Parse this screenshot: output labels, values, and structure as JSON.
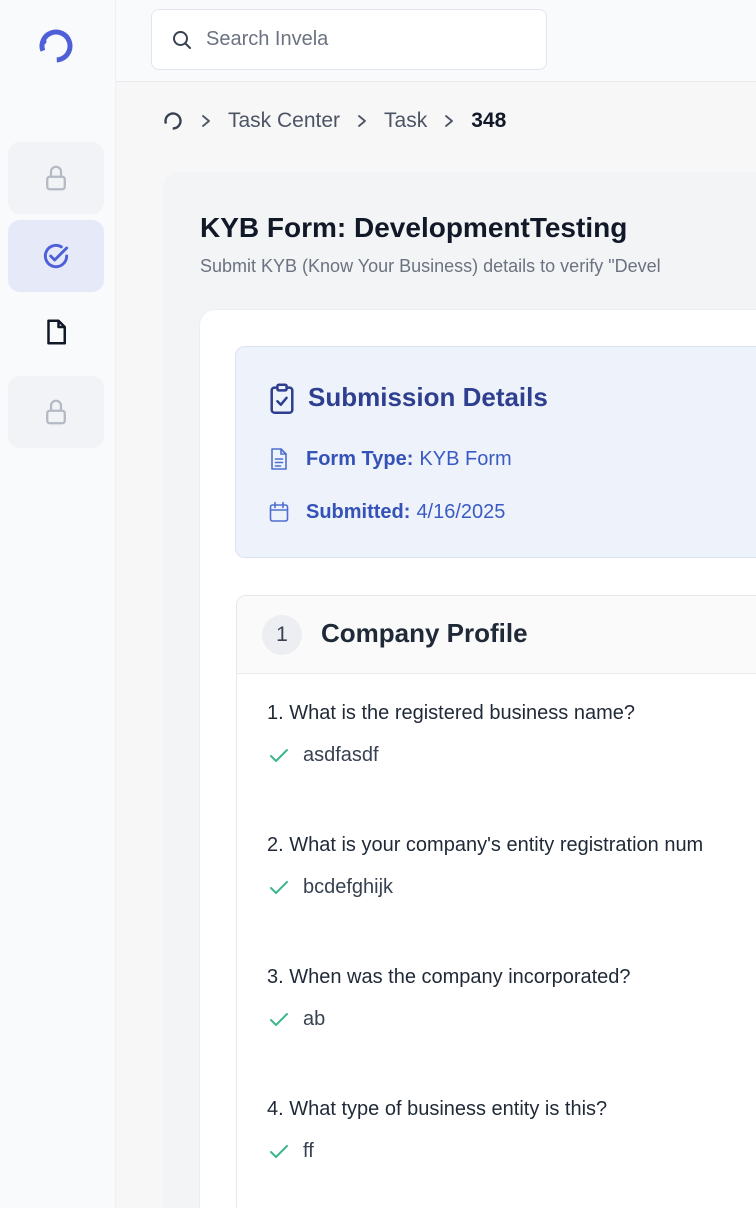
{
  "search": {
    "placeholder": "Search Invela"
  },
  "breadcrumb": {
    "items": [
      "Task Center",
      "Task"
    ],
    "current": "348"
  },
  "page": {
    "title": "KYB Form: DevelopmentTesting",
    "subtitle": "Submit KYB (Know Your Business) details to verify \"Devel"
  },
  "submission": {
    "title": "Submission Details",
    "form_type_label": "Form Type:",
    "form_type_value": "KYB Form",
    "submitted_label": "Submitted:",
    "submitted_value": "4/16/2025"
  },
  "section": {
    "number": "1",
    "title": "Company Profile",
    "questions": [
      {
        "q": "1.  What is the registered business name?",
        "a": "asdfasdf"
      },
      {
        "q": "2.  What is your company's entity registration num",
        "a": "bcdefghijk"
      },
      {
        "q": "3.  When was the company incorporated?",
        "a": "ab"
      },
      {
        "q": "4.  What type of business entity is this?",
        "a": "ff"
      }
    ]
  },
  "colors": {
    "accent": "#4f5fd8",
    "check": "#3fb58a",
    "submission_text": "#3b5bc4"
  }
}
